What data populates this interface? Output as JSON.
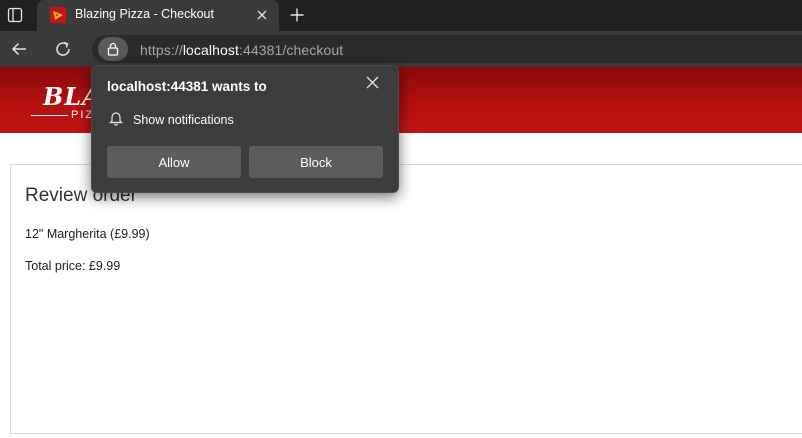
{
  "browser": {
    "tab": {
      "title": "Blazing Pizza - Checkout"
    },
    "address": {
      "scheme": "https://",
      "host": "localhost",
      "rest": ":44381/checkout"
    }
  },
  "site": {
    "logo_main": "BLAZ",
    "logo_sub": "PIZZ"
  },
  "order": {
    "heading": "Review order",
    "item": "12\" Margherita (£9.99)",
    "total": "Total price: £9.99"
  },
  "permission_popup": {
    "title": "localhost:44381 wants to",
    "permission": "Show notifications",
    "allow_label": "Allow",
    "block_label": "Block"
  },
  "colors": {
    "header_red": "#c21313",
    "chrome_dark": "#202020",
    "toolbar": "#3b3b3b",
    "popup_bg": "#3c3c3c",
    "button_bg": "#5c5c5c"
  },
  "icons": [
    "tab-actions-icon",
    "pizza-favicon-icon",
    "close-icon",
    "plus-icon",
    "back-arrow-icon",
    "refresh-icon",
    "lock-icon",
    "bell-icon"
  ]
}
